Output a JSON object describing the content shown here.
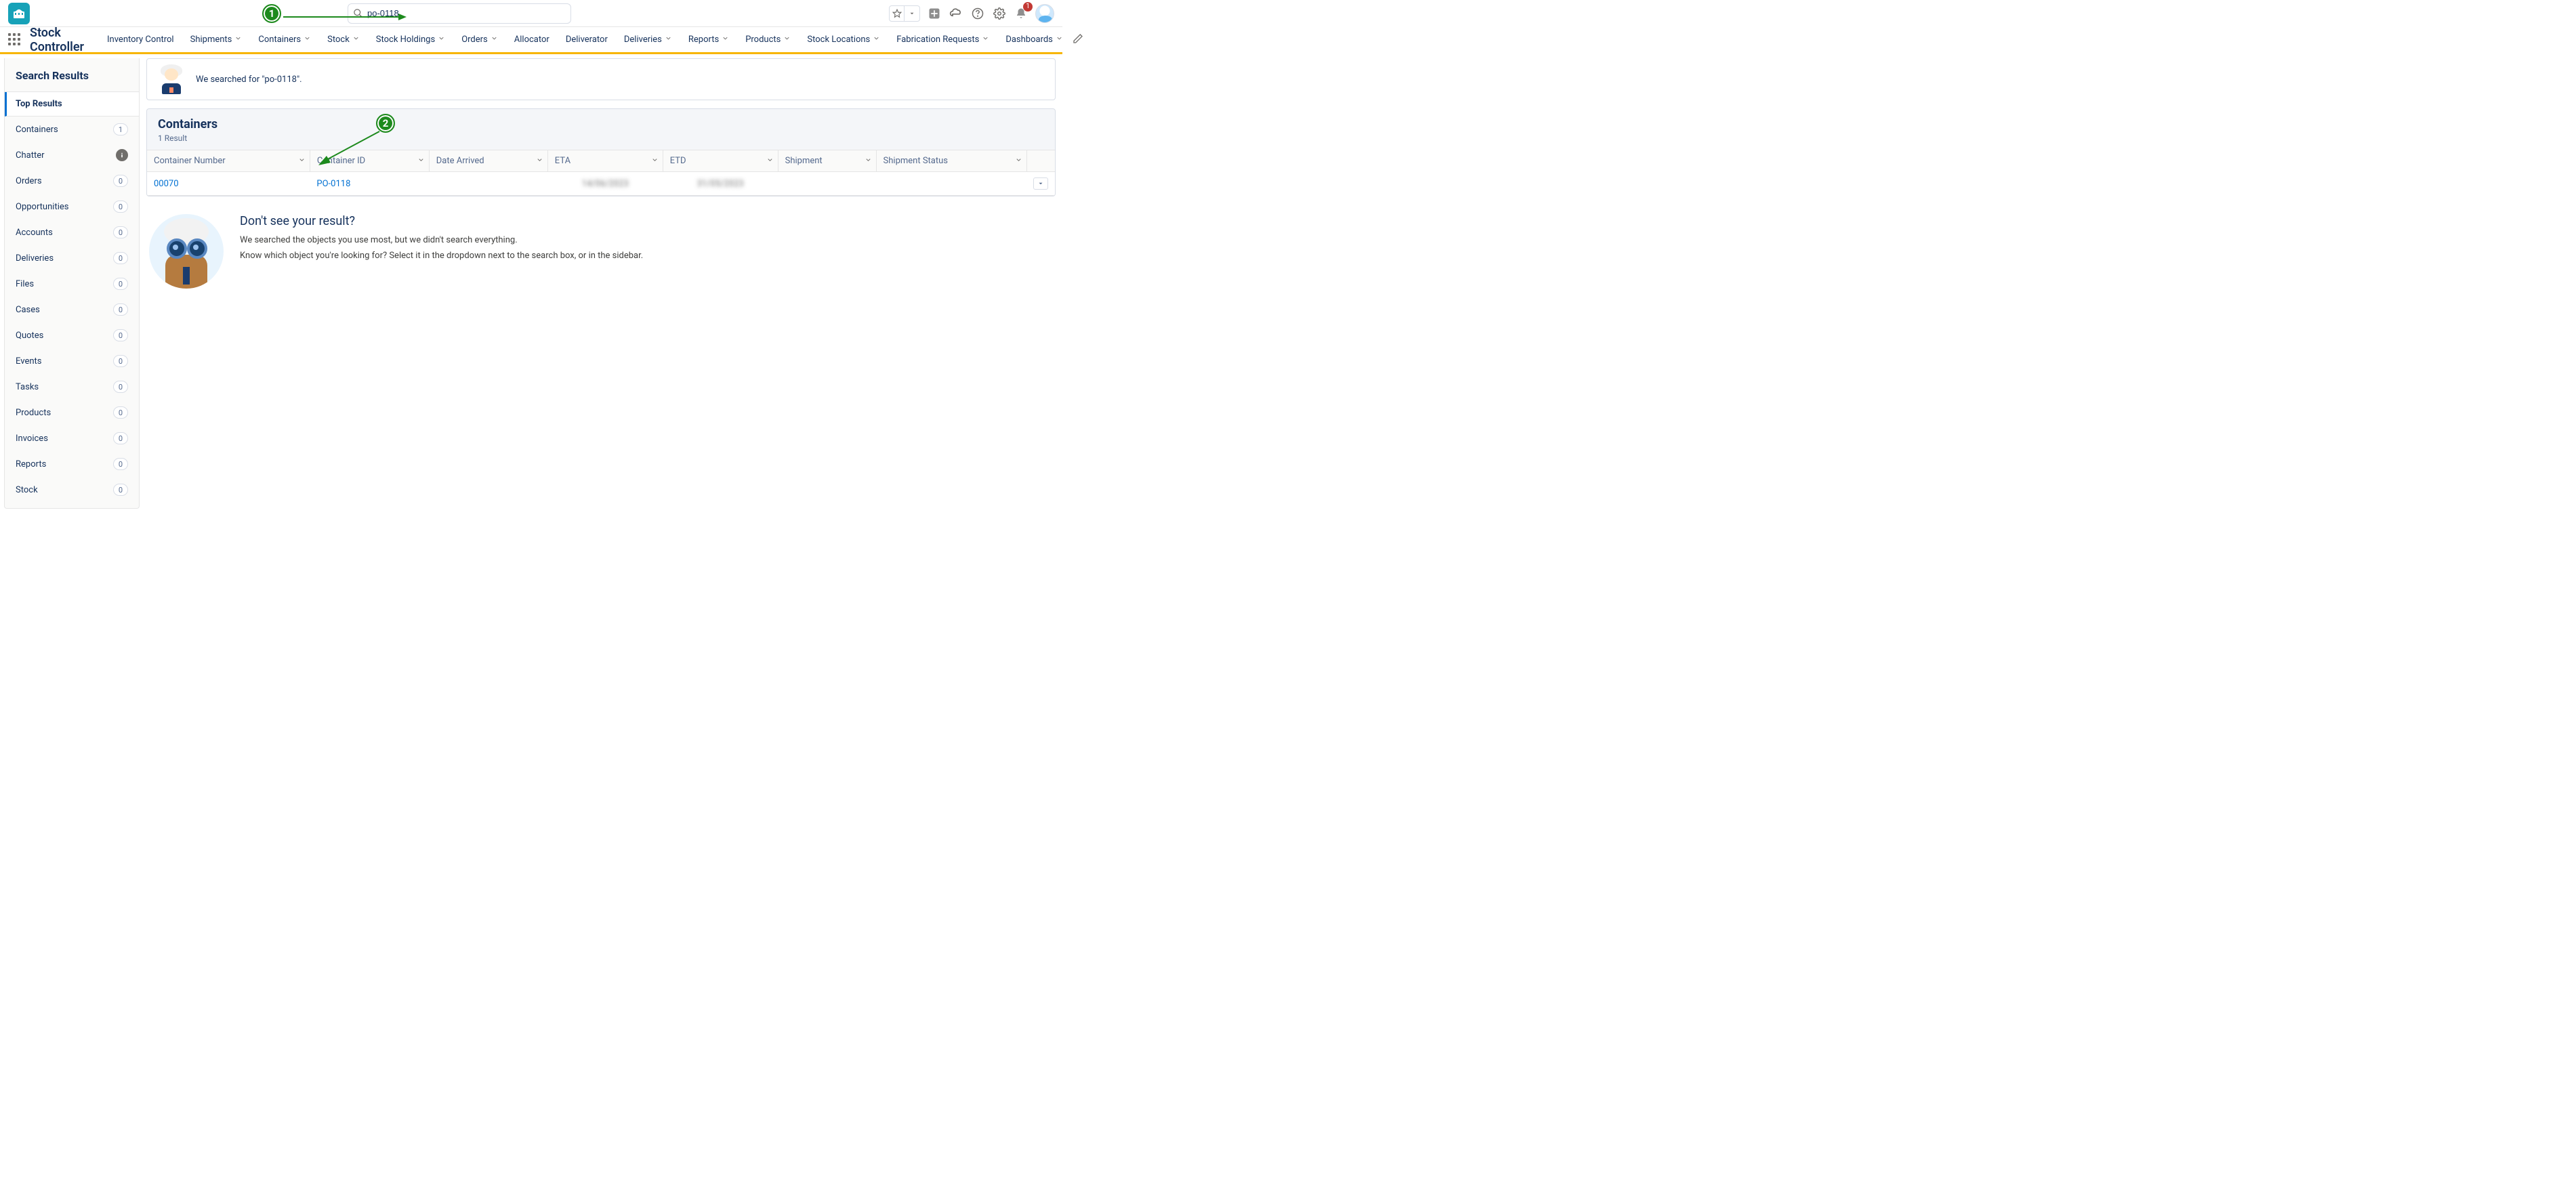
{
  "header": {
    "search_value": "po-0118",
    "notification_count": "1"
  },
  "nav": {
    "app_name": "Stock Controller",
    "items": [
      {
        "label": "Inventory Control",
        "has_dd": false
      },
      {
        "label": "Shipments",
        "has_dd": true
      },
      {
        "label": "Containers",
        "has_dd": true
      },
      {
        "label": "Stock",
        "has_dd": true
      },
      {
        "label": "Stock Holdings",
        "has_dd": true
      },
      {
        "label": "Orders",
        "has_dd": true
      },
      {
        "label": "Allocator",
        "has_dd": false
      },
      {
        "label": "Deliverator",
        "has_dd": false
      },
      {
        "label": "Deliveries",
        "has_dd": true
      },
      {
        "label": "Reports",
        "has_dd": true
      },
      {
        "label": "Products",
        "has_dd": true
      },
      {
        "label": "Stock Locations",
        "has_dd": true
      },
      {
        "label": "Fabrication Requests",
        "has_dd": true
      },
      {
        "label": "Dashboards",
        "has_dd": true
      }
    ]
  },
  "sidebar": {
    "title": "Search Results",
    "items": [
      {
        "label": "Top Results",
        "count": null,
        "selected": true,
        "info": false
      },
      {
        "label": "Containers",
        "count": "1",
        "selected": false,
        "info": false
      },
      {
        "label": "Chatter",
        "count": null,
        "selected": false,
        "info": true
      },
      {
        "label": "Orders",
        "count": "0",
        "selected": false,
        "info": false
      },
      {
        "label": "Opportunities",
        "count": "0",
        "selected": false,
        "info": false
      },
      {
        "label": "Accounts",
        "count": "0",
        "selected": false,
        "info": false
      },
      {
        "label": "Deliveries",
        "count": "0",
        "selected": false,
        "info": false
      },
      {
        "label": "Files",
        "count": "0",
        "selected": false,
        "info": false
      },
      {
        "label": "Cases",
        "count": "0",
        "selected": false,
        "info": false
      },
      {
        "label": "Quotes",
        "count": "0",
        "selected": false,
        "info": false
      },
      {
        "label": "Events",
        "count": "0",
        "selected": false,
        "info": false
      },
      {
        "label": "Tasks",
        "count": "0",
        "selected": false,
        "info": false
      },
      {
        "label": "Products",
        "count": "0",
        "selected": false,
        "info": false
      },
      {
        "label": "Invoices",
        "count": "0",
        "selected": false,
        "info": false
      },
      {
        "label": "Reports",
        "count": "0",
        "selected": false,
        "info": false
      },
      {
        "label": "Stock",
        "count": "0",
        "selected": false,
        "info": false
      }
    ]
  },
  "banner": {
    "text": "We searched for \"po-0118\"."
  },
  "results": {
    "title": "Containers",
    "subtitle": "1 Result",
    "columns": [
      "Container Number",
      "Container ID",
      "Date Arrived",
      "ETA",
      "ETD",
      "Shipment",
      "Shipment Status"
    ],
    "row": {
      "container_number": "00070",
      "container_id": "PO-0118",
      "date_arrived": "",
      "eta": "14/06/2023",
      "etd": "31/05/2023",
      "shipment": "",
      "shipment_status": ""
    }
  },
  "empty": {
    "title": "Don't see your result?",
    "line1": "We searched the objects you use most, but we didn't search everything.",
    "line2": "Know which object you're looking for? Select it in the dropdown next to the search box, or in the sidebar."
  },
  "annotations": {
    "marker1": "1",
    "marker2": "2"
  }
}
